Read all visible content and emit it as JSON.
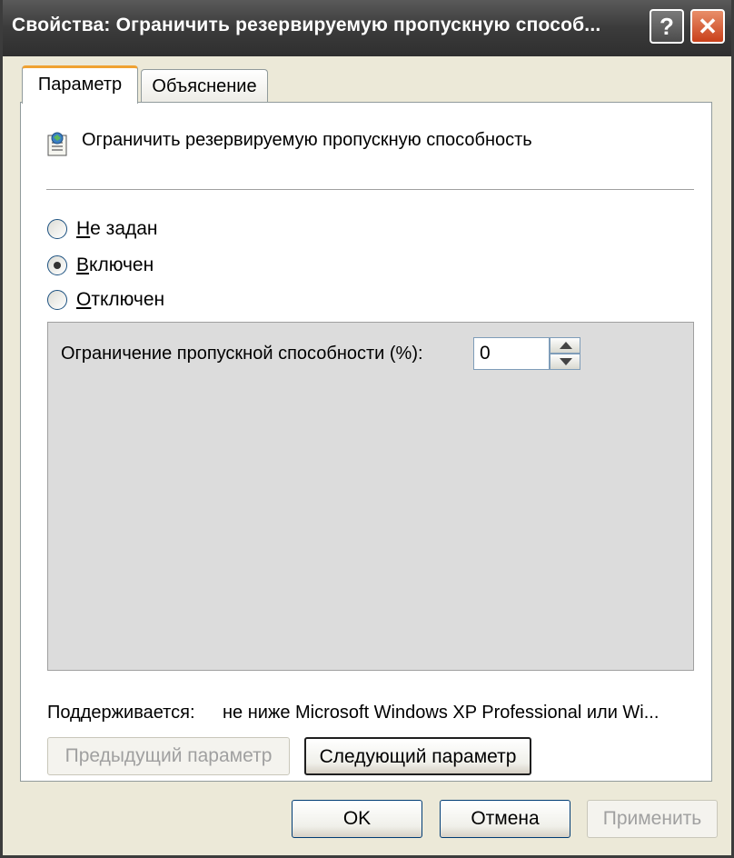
{
  "window": {
    "title": "Свойства: Ограничить резервируемую пропускную способ...",
    "help_label": "?",
    "close_label": "✕"
  },
  "tabs": [
    {
      "label": "Параметр",
      "active": true
    },
    {
      "label": "Объяснение",
      "active": false
    }
  ],
  "policy": {
    "icon": "policy-setting-icon",
    "title": "Ограничить резервируемую пропускную способность"
  },
  "state_options": [
    {
      "prefix": "",
      "accel": "Н",
      "rest": "е задан",
      "selected": false
    },
    {
      "prefix": "",
      "accel": "В",
      "rest": "ключен",
      "selected": true
    },
    {
      "prefix": "",
      "accel": "О",
      "rest": "тключен",
      "selected": false
    }
  ],
  "options": {
    "limit_label": "Ограничение пропускной способности (%):",
    "limit_value": "0"
  },
  "supported": {
    "label": "Поддерживается:",
    "value": "не ниже Microsoft Windows XP Professional или Wi..."
  },
  "nav": {
    "prev_label": "Предыдущий параметр",
    "next_label": "Следующий параметр"
  },
  "footer": {
    "ok_label": "OK",
    "cancel_label": "Отмена",
    "apply_label": "Применить"
  }
}
